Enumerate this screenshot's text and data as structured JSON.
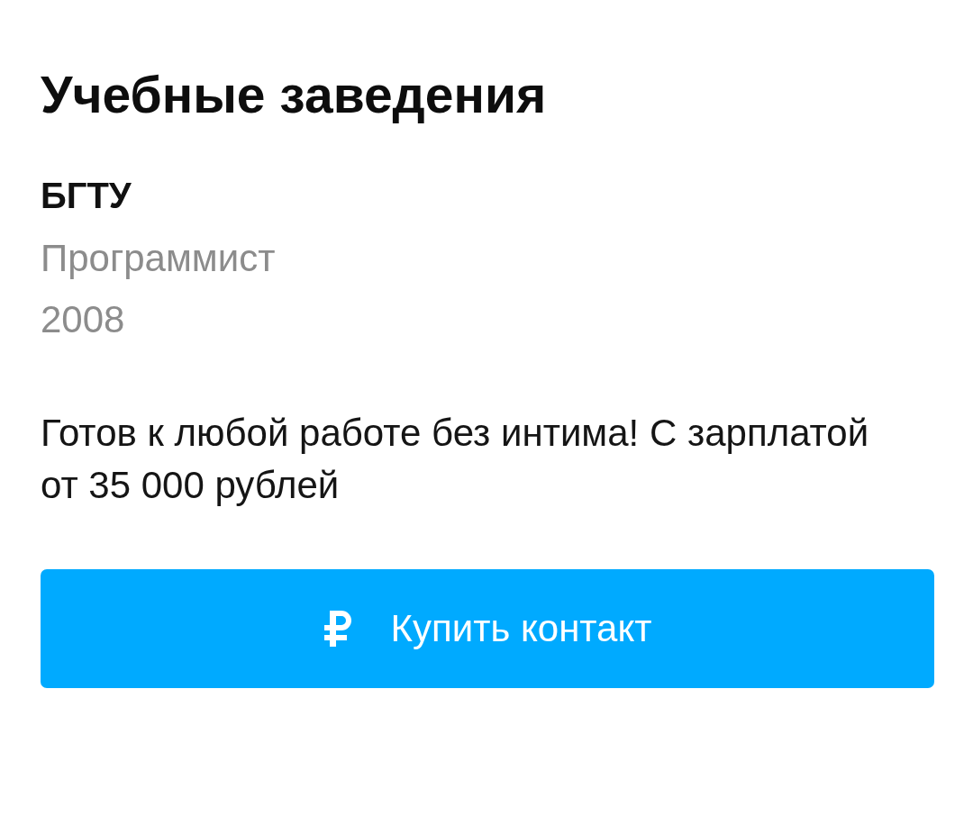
{
  "section": {
    "title": "Учебные заведения"
  },
  "education": [
    {
      "institution": "БГТУ",
      "specialty": "Программист",
      "year": "2008"
    }
  ],
  "about": "Готов к любой работе без интима! С зарплатой от 35 000 рублей",
  "buy_button": {
    "label": "Купить контакт"
  }
}
